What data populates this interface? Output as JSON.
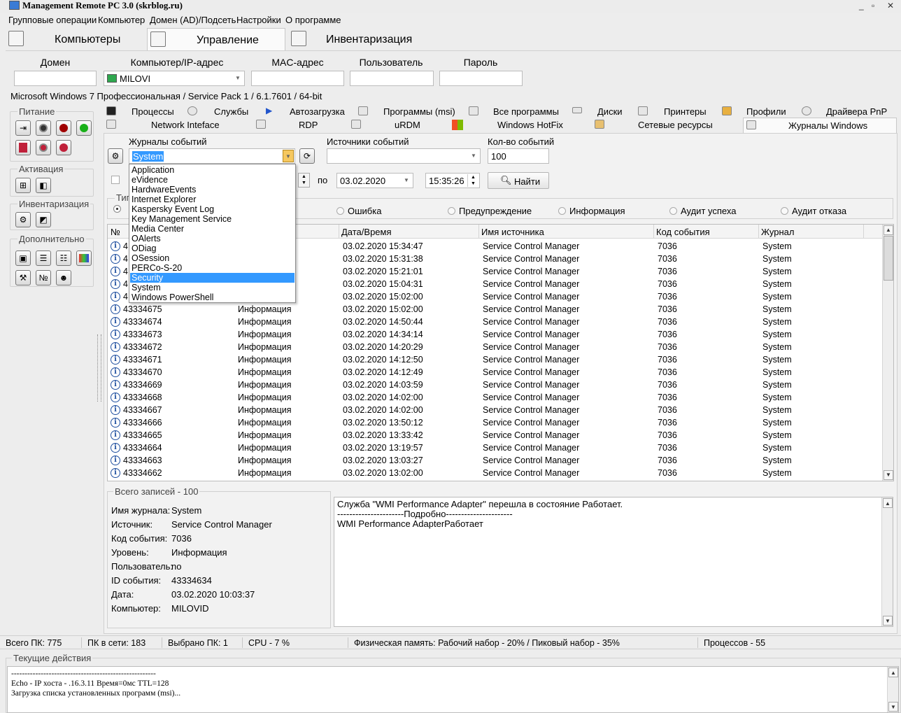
{
  "window": {
    "title": "Management Remote PC 3.0 (skrblog.ru)",
    "controls": [
      "_",
      "▫",
      "✕"
    ]
  },
  "menu": [
    "Групповые операции",
    "Компьютер",
    "Домен (AD)/Подсеть",
    "Настройки",
    "О программе"
  ],
  "main_tabs": [
    "Компьютеры",
    "Управление",
    "Инвентаризация"
  ],
  "connection": {
    "labels": {
      "domain": "Домен",
      "computer": "Компьютер/IP-адрес",
      "mac": "MAC-адрес",
      "user": "Пользователь",
      "password": "Пароль"
    },
    "computer_value": "MILOVI",
    "os_info": "Microsoft Windows 7 Профессиональная / Service Pack 1 / 6.1.7601 / 64-bit"
  },
  "left_panel": {
    "power_title": "Питание",
    "activation_title": "Активация",
    "inventory_title": "Инвентаризация",
    "extra_title": "Дополнительно",
    "extra_no_label": "№"
  },
  "sub_tabs": {
    "row1": [
      "Процессы",
      "Службы",
      "Автозагрузка",
      "Программы (msi)",
      "Все программы",
      "Диски",
      "Принтеры",
      "Профили",
      "Драйвера PnP"
    ],
    "row2": [
      "Network Inteface",
      "RDP",
      "uRDM",
      "Windows HotFix",
      "Сетевые ресурсы",
      "Журналы Windows"
    ]
  },
  "filters": {
    "logs_label": "Журналы событий",
    "logs_value": "System",
    "sources_label": "Источники событий",
    "count_label": "Кол-во событий",
    "count_value": "100",
    "to_label": "по",
    "date_to": "03.02.2020",
    "time_to": "15:35:26",
    "find_label": "Найти",
    "type_label": "Тип",
    "radios": [
      "Ошибка",
      "Предупреждение",
      "Информация",
      "Аудит успеха",
      "Аудит отказа"
    ]
  },
  "dropdown_items": [
    "Application",
    "eVidence",
    "HardwareEvents",
    "Internet Explorer",
    "Kaspersky Event Log",
    "Key Management Service",
    "Media Center",
    "OAlerts",
    "ODiag",
    "OSession",
    "PERCo-S-20",
    "Security",
    "System",
    "Windows PowerShell"
  ],
  "dropdown_selected": "Security",
  "table": {
    "columns": [
      "№",
      "Дата/Время",
      "Имя источника",
      "Код события",
      "Журнал"
    ],
    "partial_rows": [
      {
        "num": "4:",
        "datetime": "03.02.2020 15:34:47",
        "source": "Service Control Manager",
        "code": "7036",
        "log": "System"
      },
      {
        "num": "4:",
        "datetime": "03.02.2020 15:31:38",
        "source": "Service Control Manager",
        "code": "7036",
        "log": "System"
      },
      {
        "num": "4:",
        "datetime": "03.02.2020 15:21:01",
        "source": "Service Control Manager",
        "code": "7036",
        "log": "System"
      },
      {
        "num": "4:",
        "datetime": "03.02.2020 15:04:31",
        "source": "Service Control Manager",
        "code": "7036",
        "log": "System"
      },
      {
        "num": "4:",
        "datetime": "03.02.2020 15:02:00",
        "source": "Service Control Manager",
        "code": "7036",
        "log": "System"
      }
    ],
    "rows": [
      {
        "num": "43334675",
        "level": "Информация",
        "datetime": "03.02.2020 15:02:00",
        "source": "Service Control Manager",
        "code": "7036",
        "log": "System"
      },
      {
        "num": "43334674",
        "level": "Информация",
        "datetime": "03.02.2020 14:50:44",
        "source": "Service Control Manager",
        "code": "7036",
        "log": "System"
      },
      {
        "num": "43334673",
        "level": "Информация",
        "datetime": "03.02.2020 14:34:14",
        "source": "Service Control Manager",
        "code": "7036",
        "log": "System"
      },
      {
        "num": "43334672",
        "level": "Информация",
        "datetime": "03.02.2020 14:20:29",
        "source": "Service Control Manager",
        "code": "7036",
        "log": "System"
      },
      {
        "num": "43334671",
        "level": "Информация",
        "datetime": "03.02.2020 14:12:50",
        "source": "Service Control Manager",
        "code": "7036",
        "log": "System"
      },
      {
        "num": "43334670",
        "level": "Информация",
        "datetime": "03.02.2020 14:12:49",
        "source": "Service Control Manager",
        "code": "7036",
        "log": "System"
      },
      {
        "num": "43334669",
        "level": "Информация",
        "datetime": "03.02.2020 14:03:59",
        "source": "Service Control Manager",
        "code": "7036",
        "log": "System"
      },
      {
        "num": "43334668",
        "level": "Информация",
        "datetime": "03.02.2020 14:02:00",
        "source": "Service Control Manager",
        "code": "7036",
        "log": "System"
      },
      {
        "num": "43334667",
        "level": "Информация",
        "datetime": "03.02.2020 14:02:00",
        "source": "Service Control Manager",
        "code": "7036",
        "log": "System"
      },
      {
        "num": "43334666",
        "level": "Информация",
        "datetime": "03.02.2020 13:50:12",
        "source": "Service Control Manager",
        "code": "7036",
        "log": "System"
      },
      {
        "num": "43334665",
        "level": "Информация",
        "datetime": "03.02.2020 13:33:42",
        "source": "Service Control Manager",
        "code": "7036",
        "log": "System"
      },
      {
        "num": "43334664",
        "level": "Информация",
        "datetime": "03.02.2020 13:19:57",
        "source": "Service Control Manager",
        "code": "7036",
        "log": "System"
      },
      {
        "num": "43334663",
        "level": "Информация",
        "datetime": "03.02.2020 13:03:27",
        "source": "Service Control Manager",
        "code": "7036",
        "log": "System"
      },
      {
        "num": "43334662",
        "level": "Информация",
        "datetime": "03.02.2020 13:02:00",
        "source": "Service Control Manager",
        "code": "7036",
        "log": "System"
      }
    ]
  },
  "details": {
    "group_title": "Всего записей - 100",
    "fields": [
      {
        "label": "Имя журнала:",
        "value": "System"
      },
      {
        "label": "Источник:",
        "value": "Service Control Manager"
      },
      {
        "label": "Код события:",
        "value": "7036"
      },
      {
        "label": "Уровень:",
        "value": "Информация"
      },
      {
        "label": "Пользователь:",
        "value": "no"
      },
      {
        "label": "ID события:",
        "value": "43334634"
      },
      {
        "label": "Дата:",
        "value": "03.02.2020 10:03:37"
      },
      {
        "label": "Компьютер:",
        "value": "MILOVID"
      }
    ],
    "message_lines": [
      "Служба \"WMI Performance Adapter\" перешла в состояние Работает.",
      "----------------------Подробно----------------------",
      "WMI Performance AdapterРаботает"
    ]
  },
  "status": {
    "total": "Всего ПК: 775",
    "online": "ПК в сети: 183",
    "selected": "Выбрано ПК: 1",
    "cpu": "CPU - 7 %",
    "memory": "Физическая память: Рабочий набор - 20% / Пиковый набор - 35%",
    "processes": "Процессов - 55"
  },
  "actions": {
    "title": "Текущие действия",
    "lines": [
      "------------------------------------------------------",
      "Echo - IP хоста -       .16.3.11    Время=0мс  TTL=128",
      "Загрузка списка установленных программ (msi)..."
    ]
  },
  "colors": {
    "selection": "#3399ff",
    "power_red": "#a00000",
    "power_green": "#19b019"
  }
}
